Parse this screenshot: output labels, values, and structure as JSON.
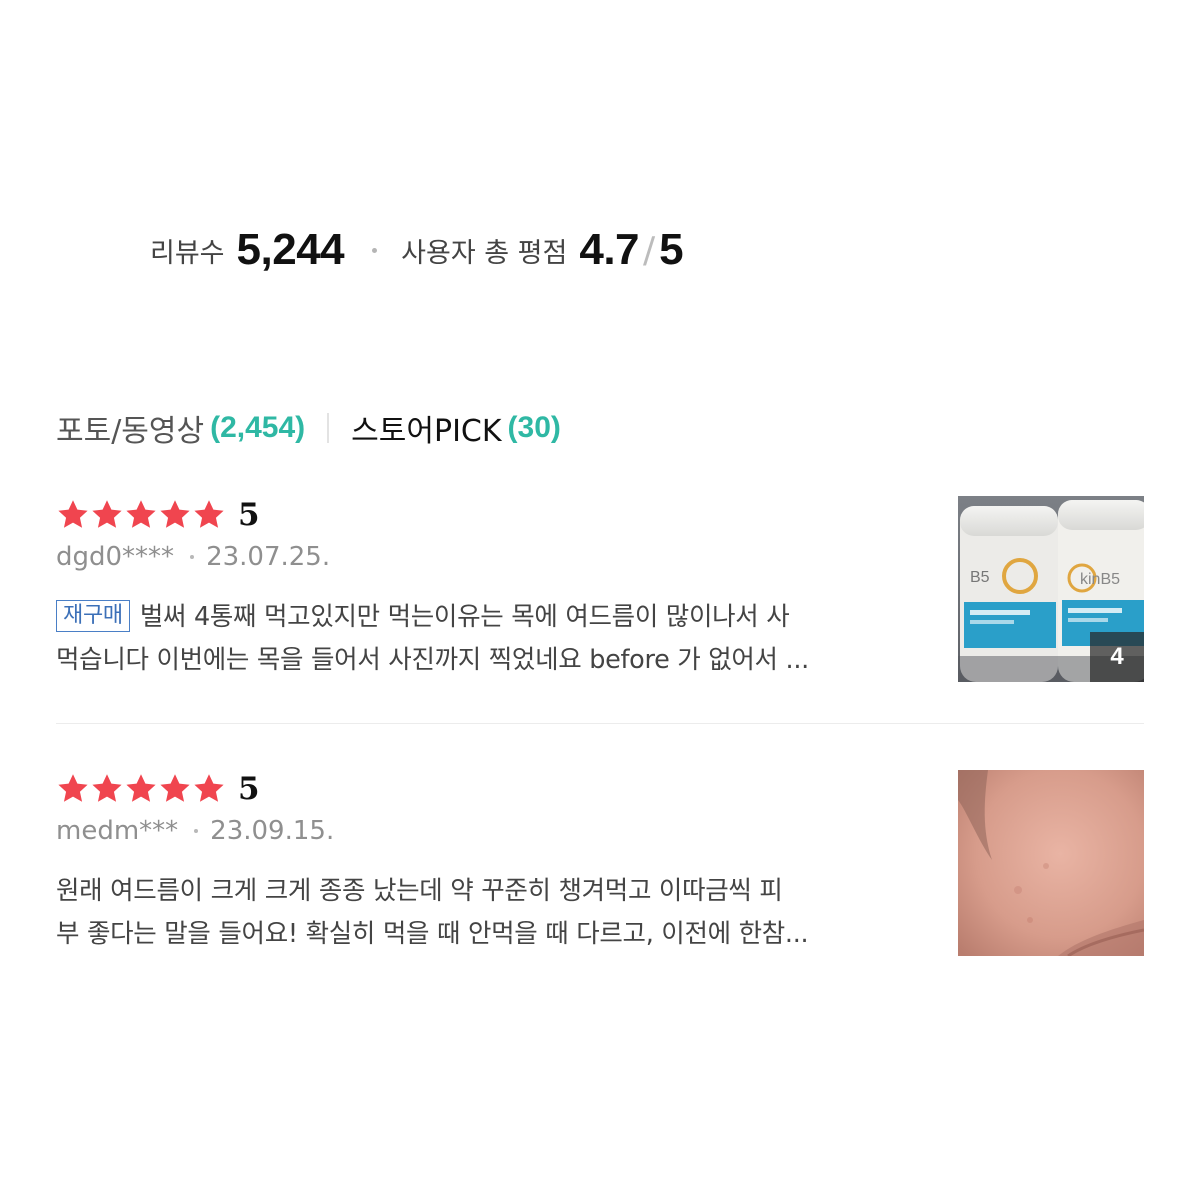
{
  "summary": {
    "review_count_label": "리뷰수",
    "review_count": "5,244",
    "avg_label": "사용자 총 평점",
    "avg_score": "4.7",
    "slash": "/",
    "max_score": "5"
  },
  "tabs": [
    {
      "label": "포토/동영상",
      "count": "(2,454)"
    },
    {
      "label": "스토어PICK",
      "count": "(30)"
    }
  ],
  "star_color": "#f0454f",
  "reviews": [
    {
      "stars": 5,
      "rating": "5",
      "user": "dgd0****",
      "date": "23.07.25.",
      "badge": "재구매",
      "line1": "벌써 4통째 먹고있지만 먹는이유는 목에 여드름이 많이나서 사",
      "line2": "먹습니다 이번에는 목을 들어서 사진까지 찍었네요 before 가 없어서 ...",
      "photo_count": "4",
      "thumbnail": "product-bottles-photo"
    },
    {
      "stars": 5,
      "rating": "5",
      "user": "medm***",
      "date": "23.09.15.",
      "line1": "원래 여드름이 크게 크게 종종 났는데 약 꾸준히 챙겨먹고 이따금씩 피",
      "line2": "부 좋다는 말을 들어요! 확실히 먹을 때 안먹을 때 다르고, 이전에 한참...",
      "thumbnail": "skin-closeup-photo"
    }
  ]
}
